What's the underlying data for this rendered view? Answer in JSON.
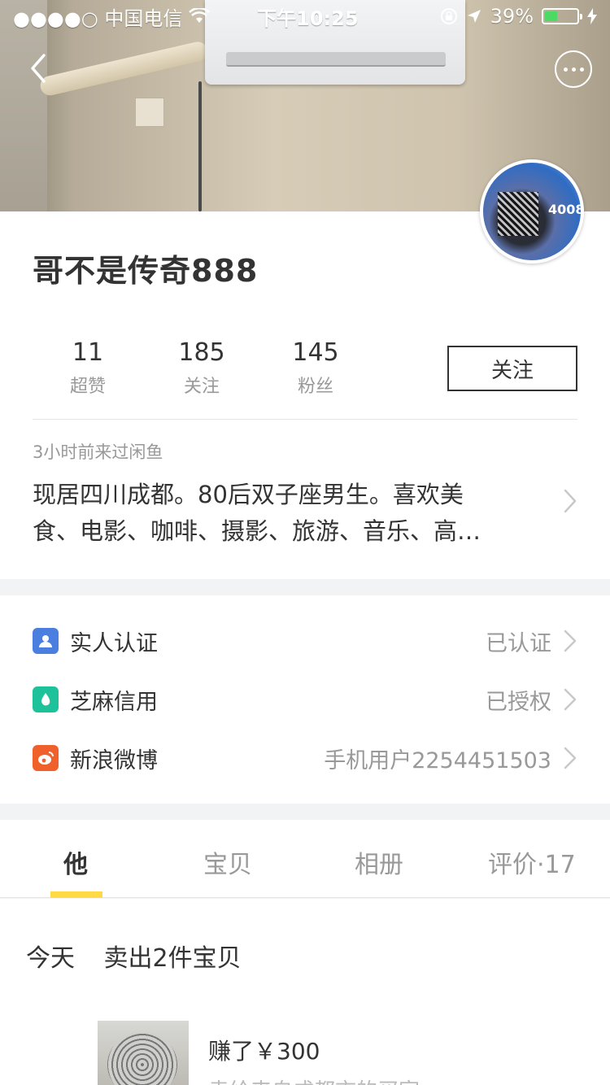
{
  "status_bar": {
    "carrier": "●●●●○ 中国电信",
    "time": "下午10:25",
    "battery_text": "39%",
    "battery_level": 0.39,
    "colors": {
      "battery_fill": "#4cd964"
    }
  },
  "nav": {
    "back_icon": "chevron-left-icon",
    "more_icon": "ellipsis-circle-icon"
  },
  "profile": {
    "username": "哥不是传奇888",
    "stats": [
      {
        "value": "11",
        "label": "超赞"
      },
      {
        "value": "185",
        "label": "关注"
      },
      {
        "value": "145",
        "label": "粉丝"
      }
    ],
    "follow_label": "关注",
    "last_seen": "3小时前来过闲鱼",
    "bio_line1": "现居四川成都。80后双子座男生。喜欢美",
    "bio_line2": "食、电影、咖啡、摄影、旅游、音乐、高…",
    "avatar_text": "4008"
  },
  "verifications": [
    {
      "name": "实人认证",
      "value": "已认证",
      "icon": "person-badge-icon",
      "color": "#4a7fe0"
    },
    {
      "name": "芝麻信用",
      "value": "已授权",
      "icon": "sesame-credit-icon",
      "color": "#1ec29a"
    },
    {
      "name": "新浪微博",
      "value": "手机用户2254451503",
      "icon": "weibo-icon",
      "color": "#f0602a"
    }
  ],
  "tabs": {
    "items": [
      "他",
      "宝贝",
      "相册",
      "评价·17"
    ],
    "active_index": 0,
    "colors": {
      "underline": "#ffda44"
    }
  },
  "feed": {
    "day": "今天",
    "summary": "卖出2件宝贝",
    "earned": "赚了￥300",
    "sold_to": "卖给来自成都市的买家"
  }
}
